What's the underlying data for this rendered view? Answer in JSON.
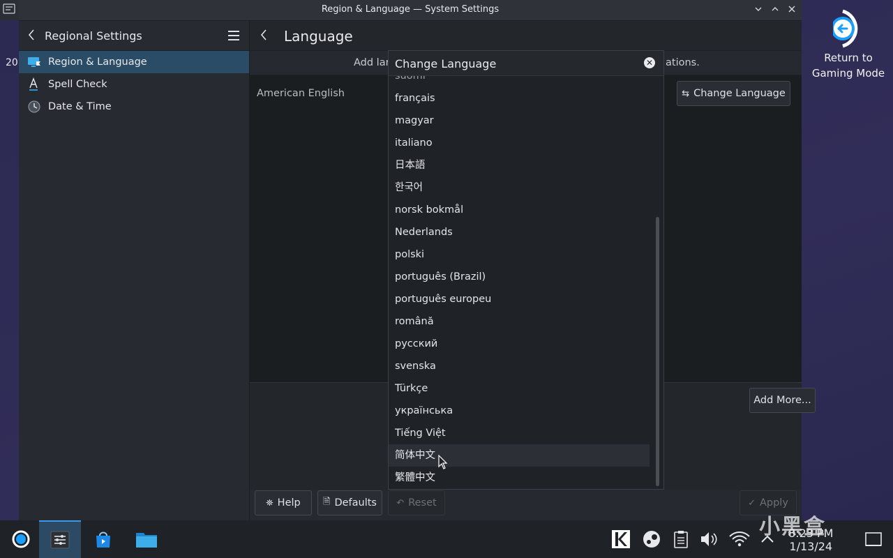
{
  "window": {
    "title": "Region & Language — System Settings",
    "minimize_label": "⌄",
    "maximize_label": "⌃",
    "close_label": "✕"
  },
  "desktop": {
    "left_fragment": "20",
    "return_label_line1": "Return to",
    "return_label_line2": "Gaming Mode"
  },
  "sidebar": {
    "title": "Regional Settings",
    "items": [
      {
        "label": "Region & Language",
        "icon": "monitor-flag-icon"
      },
      {
        "label": "Spell Check",
        "icon": "spell-check-icon"
      },
      {
        "label": "Date & Time",
        "icon": "clock-icon"
      }
    ]
  },
  "content": {
    "title": "Language",
    "info_left": "Add lar",
    "info_right": "ations.",
    "current_language": "American English",
    "change_language_button": "Change Language",
    "add_more_button": "Add More..."
  },
  "bottom": {
    "help": "Help",
    "defaults": "Defaults",
    "reset": "Reset",
    "apply": "Apply"
  },
  "dialog": {
    "title": "Change Language",
    "partial_top": "suomi",
    "languages": [
      "français",
      "magyar",
      "italiano",
      "日本語",
      "한국어",
      "norsk bokmål",
      "Nederlands",
      "polski",
      "português (Brazil)",
      "português europeu",
      "română",
      "русский",
      "svenska",
      "Türkçe",
      "українська",
      "Tiếng Việt",
      "简体中文",
      "繁體中文"
    ],
    "hovered_index": 16
  },
  "taskbar": {
    "time": "8:23 PM",
    "date": "1/13/24",
    "watermark": "小黑盒"
  },
  "colors": {
    "accent": "#3d9ae8",
    "selection": "#2b4c66",
    "window_bg": "#23272c"
  }
}
